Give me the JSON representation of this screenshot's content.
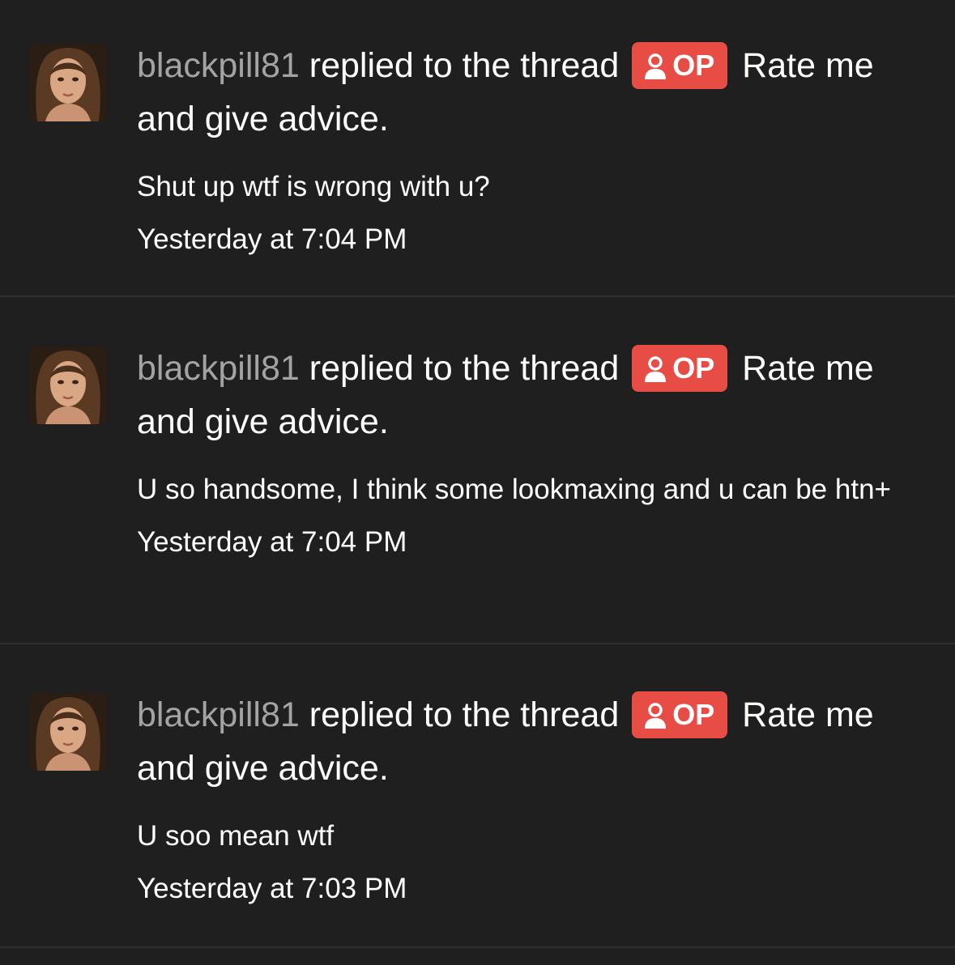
{
  "alerts": [
    {
      "username": "blackpill81",
      "action": "replied to the thread",
      "badge": "OP",
      "thread_title": "Rate me and give advice.",
      "snippet": "Shut up wtf is wrong with u?",
      "time": "Yesterday at 7:04 PM"
    },
    {
      "username": "blackpill81",
      "action": "replied to the thread",
      "badge": "OP",
      "thread_title": "Rate me and give advice.",
      "snippet": "U so handsome, I think some lookmaxing and u can be htn+",
      "time": "Yesterday at 7:04 PM"
    },
    {
      "username": "blackpill81",
      "action": "replied to the thread",
      "badge": "OP",
      "thread_title": "Rate me and give advice.",
      "snippet": "U soo mean wtf",
      "time": "Yesterday at 7:03 PM"
    }
  ],
  "colors": {
    "background": "#1f1f1f",
    "divider": "#2e2e2e",
    "username": "#a3a3a3",
    "badge": "#e74c45",
    "text": "#ffffff"
  },
  "icons": {
    "badge_icon": "user-icon"
  }
}
